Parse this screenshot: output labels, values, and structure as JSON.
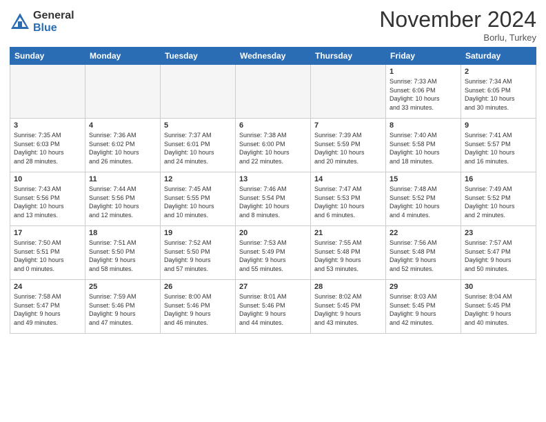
{
  "header": {
    "logo_general": "General",
    "logo_blue": "Blue",
    "month_title": "November 2024",
    "location": "Borlu, Turkey"
  },
  "days_of_week": [
    "Sunday",
    "Monday",
    "Tuesday",
    "Wednesday",
    "Thursday",
    "Friday",
    "Saturday"
  ],
  "weeks": [
    [
      {
        "day": "",
        "info": "",
        "empty": true
      },
      {
        "day": "",
        "info": "",
        "empty": true
      },
      {
        "day": "",
        "info": "",
        "empty": true
      },
      {
        "day": "",
        "info": "",
        "empty": true
      },
      {
        "day": "",
        "info": "",
        "empty": true
      },
      {
        "day": "1",
        "info": "Sunrise: 7:33 AM\nSunset: 6:06 PM\nDaylight: 10 hours\nand 33 minutes."
      },
      {
        "day": "2",
        "info": "Sunrise: 7:34 AM\nSunset: 6:05 PM\nDaylight: 10 hours\nand 30 minutes."
      }
    ],
    [
      {
        "day": "3",
        "info": "Sunrise: 7:35 AM\nSunset: 6:03 PM\nDaylight: 10 hours\nand 28 minutes."
      },
      {
        "day": "4",
        "info": "Sunrise: 7:36 AM\nSunset: 6:02 PM\nDaylight: 10 hours\nand 26 minutes."
      },
      {
        "day": "5",
        "info": "Sunrise: 7:37 AM\nSunset: 6:01 PM\nDaylight: 10 hours\nand 24 minutes."
      },
      {
        "day": "6",
        "info": "Sunrise: 7:38 AM\nSunset: 6:00 PM\nDaylight: 10 hours\nand 22 minutes."
      },
      {
        "day": "7",
        "info": "Sunrise: 7:39 AM\nSunset: 5:59 PM\nDaylight: 10 hours\nand 20 minutes."
      },
      {
        "day": "8",
        "info": "Sunrise: 7:40 AM\nSunset: 5:58 PM\nDaylight: 10 hours\nand 18 minutes."
      },
      {
        "day": "9",
        "info": "Sunrise: 7:41 AM\nSunset: 5:57 PM\nDaylight: 10 hours\nand 16 minutes."
      }
    ],
    [
      {
        "day": "10",
        "info": "Sunrise: 7:43 AM\nSunset: 5:56 PM\nDaylight: 10 hours\nand 13 minutes."
      },
      {
        "day": "11",
        "info": "Sunrise: 7:44 AM\nSunset: 5:56 PM\nDaylight: 10 hours\nand 12 minutes."
      },
      {
        "day": "12",
        "info": "Sunrise: 7:45 AM\nSunset: 5:55 PM\nDaylight: 10 hours\nand 10 minutes."
      },
      {
        "day": "13",
        "info": "Sunrise: 7:46 AM\nSunset: 5:54 PM\nDaylight: 10 hours\nand 8 minutes."
      },
      {
        "day": "14",
        "info": "Sunrise: 7:47 AM\nSunset: 5:53 PM\nDaylight: 10 hours\nand 6 minutes."
      },
      {
        "day": "15",
        "info": "Sunrise: 7:48 AM\nSunset: 5:52 PM\nDaylight: 10 hours\nand 4 minutes."
      },
      {
        "day": "16",
        "info": "Sunrise: 7:49 AM\nSunset: 5:52 PM\nDaylight: 10 hours\nand 2 minutes."
      }
    ],
    [
      {
        "day": "17",
        "info": "Sunrise: 7:50 AM\nSunset: 5:51 PM\nDaylight: 10 hours\nand 0 minutes."
      },
      {
        "day": "18",
        "info": "Sunrise: 7:51 AM\nSunset: 5:50 PM\nDaylight: 9 hours\nand 58 minutes."
      },
      {
        "day": "19",
        "info": "Sunrise: 7:52 AM\nSunset: 5:50 PM\nDaylight: 9 hours\nand 57 minutes."
      },
      {
        "day": "20",
        "info": "Sunrise: 7:53 AM\nSunset: 5:49 PM\nDaylight: 9 hours\nand 55 minutes."
      },
      {
        "day": "21",
        "info": "Sunrise: 7:55 AM\nSunset: 5:48 PM\nDaylight: 9 hours\nand 53 minutes."
      },
      {
        "day": "22",
        "info": "Sunrise: 7:56 AM\nSunset: 5:48 PM\nDaylight: 9 hours\nand 52 minutes."
      },
      {
        "day": "23",
        "info": "Sunrise: 7:57 AM\nSunset: 5:47 PM\nDaylight: 9 hours\nand 50 minutes."
      }
    ],
    [
      {
        "day": "24",
        "info": "Sunrise: 7:58 AM\nSunset: 5:47 PM\nDaylight: 9 hours\nand 49 minutes."
      },
      {
        "day": "25",
        "info": "Sunrise: 7:59 AM\nSunset: 5:46 PM\nDaylight: 9 hours\nand 47 minutes."
      },
      {
        "day": "26",
        "info": "Sunrise: 8:00 AM\nSunset: 5:46 PM\nDaylight: 9 hours\nand 46 minutes."
      },
      {
        "day": "27",
        "info": "Sunrise: 8:01 AM\nSunset: 5:46 PM\nDaylight: 9 hours\nand 44 minutes."
      },
      {
        "day": "28",
        "info": "Sunrise: 8:02 AM\nSunset: 5:45 PM\nDaylight: 9 hours\nand 43 minutes."
      },
      {
        "day": "29",
        "info": "Sunrise: 8:03 AM\nSunset: 5:45 PM\nDaylight: 9 hours\nand 42 minutes."
      },
      {
        "day": "30",
        "info": "Sunrise: 8:04 AM\nSunset: 5:45 PM\nDaylight: 9 hours\nand 40 minutes."
      }
    ]
  ]
}
